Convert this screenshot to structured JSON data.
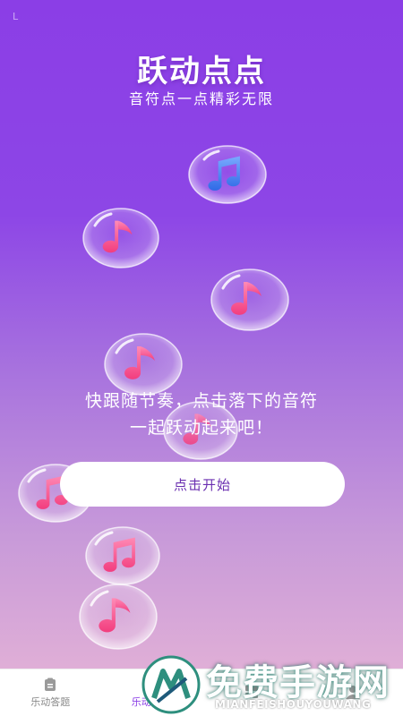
{
  "status": {
    "mark": "L"
  },
  "hero": {
    "title": "跃动点点",
    "subtitle": "音符点一点精彩无限"
  },
  "instruction": {
    "line1": "快跟随节奏，点击落下的音符",
    "line2": "一起跃动起来吧！"
  },
  "start_button": {
    "label": "点击开始"
  },
  "bottom_nav": {
    "items": [
      {
        "label": "乐动答题",
        "icon": "clipboard-icon"
      },
      {
        "label": "乐动点点",
        "icon": "music-note-icon"
      },
      {
        "label": "",
        "icon": "grid-icon"
      },
      {
        "label": "",
        "icon": "user-icon"
      }
    ]
  },
  "watermark": {
    "title": "免费手游网",
    "subtitle": "MIANFEISHOUYOUWANG"
  },
  "colors": {
    "gradient_top": "#8b3ee6",
    "gradient_bottom": "#e8b6d6",
    "note_pink": "#ff4f8f",
    "note_blue": "#3f7cf0",
    "button_text": "#6a2fb0"
  }
}
